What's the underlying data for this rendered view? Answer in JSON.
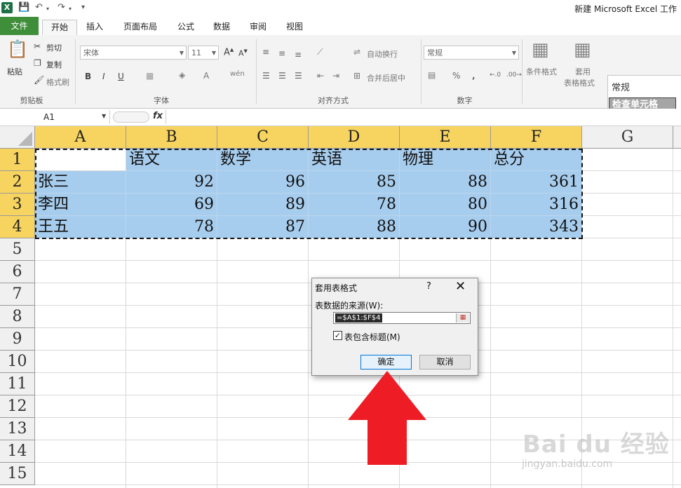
{
  "window": {
    "title": "新建 Microsoft Excel 工作"
  },
  "tabs": [
    "文件",
    "开始",
    "插入",
    "页面布局",
    "公式",
    "数据",
    "审阅",
    "视图"
  ],
  "ribbon": {
    "clipboard": {
      "paste": "粘贴",
      "cut": "剪切",
      "copy": "复制",
      "format_painter": "格式刷",
      "label": "剪贴板"
    },
    "font": {
      "name": "宋体",
      "size": "11",
      "label": "字体"
    },
    "alignment": {
      "wrap": "自动换行",
      "merge": "合并后居中",
      "label": "对齐方式"
    },
    "number": {
      "format": "常规",
      "label": "数字"
    },
    "styles": {
      "conditional": "条件格式",
      "table_line1": "套用",
      "table_line2": "表格格式",
      "style_normal": "常规",
      "style_check": "检查单元格"
    }
  },
  "formula_bar": {
    "name_box": "A1",
    "fx": "fx"
  },
  "sheet": {
    "columns": [
      "A",
      "B",
      "C",
      "D",
      "E",
      "F",
      "G"
    ],
    "rows": [
      "1",
      "2",
      "3",
      "4",
      "5",
      "6",
      "7",
      "8",
      "9",
      "10",
      "11",
      "12",
      "13",
      "14",
      "15"
    ],
    "header": [
      "",
      "语文",
      "数学",
      "英语",
      "物理",
      "总分"
    ],
    "data": [
      [
        "张三",
        "92",
        "96",
        "85",
        "88",
        "361"
      ],
      [
        "李四",
        "69",
        "89",
        "78",
        "80",
        "316"
      ],
      [
        "王五",
        "78",
        "87",
        "88",
        "90",
        "343"
      ]
    ]
  },
  "dialog": {
    "title": "套用表格式",
    "help": "?",
    "close": "✕",
    "source_label": "表数据的来源(W):",
    "source_value": "=$A$1:$F$4",
    "checkbox_label": "表包含标题(M)",
    "checkbox_checked": true,
    "ok": "确定",
    "cancel": "取消"
  },
  "watermark": {
    "logo": "Bai du 经验",
    "url": "jingyan.baidu.com"
  },
  "colors": {
    "file_tab": "#3f8e3a",
    "selection": "#a7cdee",
    "header_highlight": "#f7d460",
    "arrow": "#ee1c24"
  }
}
